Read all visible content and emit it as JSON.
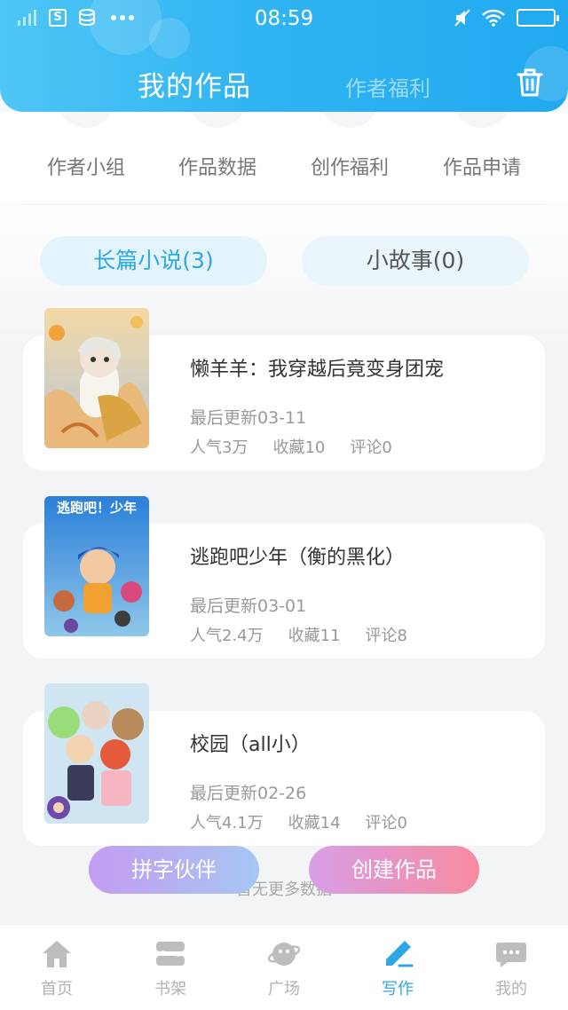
{
  "status_bar": {
    "time": "08:59"
  },
  "header": {
    "active_tab": "我的作品",
    "inactive_tab": "作者福利",
    "trash_icon": "trash-icon"
  },
  "shortcuts": [
    {
      "label": "作者小组"
    },
    {
      "label": "作品数据"
    },
    {
      "label": "创作福利"
    },
    {
      "label": "作品申请"
    }
  ],
  "segments": {
    "long": "长篇小说(3)",
    "short": "小故事(0)"
  },
  "works": [
    {
      "title": "懒羊羊：我穿越后竟变身团宠",
      "update": "最后更新03-11",
      "popularity": "人气3万",
      "favorites": "收藏10",
      "comments": "评论0"
    },
    {
      "title": "逃跑吧少年（衡的黑化）",
      "update": "最后更新03-01",
      "popularity": "人气2.4万",
      "favorites": "收藏11",
      "comments": "评论8",
      "cover_text": "逃跑吧！少年"
    },
    {
      "title": "校园（all小）",
      "update": "最后更新02-26",
      "popularity": "人气4.1万",
      "favorites": "收藏14",
      "comments": "评论0"
    }
  ],
  "no_more": "暂无更多数据",
  "actions": {
    "partner": "拼字伙伴",
    "create": "创建作品"
  },
  "tabbar": [
    {
      "label": "首页",
      "icon": "home-icon"
    },
    {
      "label": "书架",
      "icon": "bookshelf-icon"
    },
    {
      "label": "广场",
      "icon": "planet-icon"
    },
    {
      "label": "写作",
      "icon": "pen-icon",
      "active": true
    },
    {
      "label": "我的",
      "icon": "chat-bubble-icon"
    }
  ],
  "colors": {
    "accent": "#2ea7e6",
    "header_start": "#4fc6f6",
    "header_end": "#22a9ef"
  }
}
